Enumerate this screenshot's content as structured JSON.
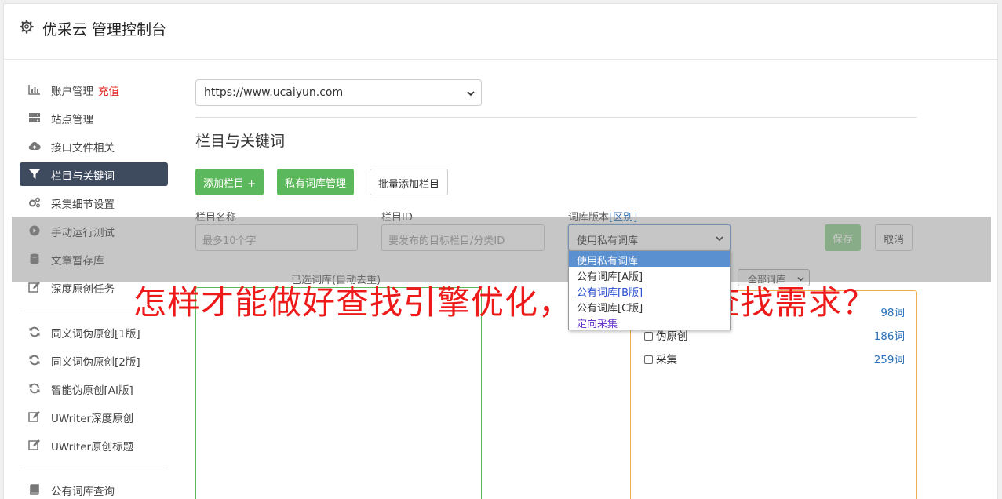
{
  "header": {
    "icon": "gear-icon",
    "title": "优采云 管理控制台"
  },
  "sidebar": {
    "items": [
      {
        "label": "账户管理",
        "badge": "充值",
        "icon": "bar-chart-icon"
      },
      {
        "label": "站点管理",
        "icon": "server-icon"
      },
      {
        "label": "接口文件相关",
        "icon": "cloud-upload-icon"
      },
      {
        "label": "栏目与关键词",
        "icon": "filter-icon",
        "active": true
      },
      {
        "label": "采集细节设置",
        "icon": "cogs-icon"
      },
      {
        "label": "手动运行测试",
        "icon": "play-circle-icon"
      },
      {
        "label": "文章暂存库",
        "icon": "database-icon"
      },
      {
        "label": "深度原创任务",
        "icon": "edit-icon"
      },
      {
        "label": "同义词伪原创[1版]",
        "icon": "refresh-icon"
      },
      {
        "label": "同义词伪原创[2版]",
        "icon": "refresh-icon"
      },
      {
        "label": "智能伪原创[AI版]",
        "icon": "refresh-icon"
      },
      {
        "label": "UWriter深度原创",
        "icon": "edit-icon"
      },
      {
        "label": "UWriter原创标题",
        "icon": "edit-icon"
      },
      {
        "label": "公有词库查询",
        "icon": "book-icon"
      }
    ]
  },
  "main": {
    "site_select": "https://www.ucaiyun.com",
    "section_title": "栏目与关键词",
    "buttons": {
      "add_column": "添加栏目 +",
      "private_lib": "私有词库管理",
      "batch_add": "批量添加栏目",
      "save": "保存",
      "cancel": "取消"
    },
    "form": {
      "name_label": "栏目名称",
      "name_placeholder": "最多10个字",
      "id_label": "栏目ID",
      "id_placeholder": "要发布的目标栏目/分类ID",
      "version_label": "词库版本",
      "version_link": "[区别]",
      "version_value": "使用私有词库",
      "version_options": [
        "使用私有词库",
        "公有词库[A版]",
        "公有词库[B版]",
        "公有词库[C版]",
        "定向采集"
      ]
    },
    "selected_lib_label": "已选词库(自动去重)",
    "all_lib_select": "全部词库",
    "libs": [
      {
        "label": "",
        "count": "98词"
      },
      {
        "label": "伪原创",
        "count": "186词"
      },
      {
        "label": "采集",
        "count": "259词"
      }
    ]
  },
  "caption": "怎样才能做好查找引擎优化，满意用户查找需求？",
  "colors": {
    "accent_green": "#5cb85c",
    "sidebar_active": "#3e4a5e",
    "link_blue": "#2a6fb6",
    "caption_red": "#ee1a1a"
  }
}
